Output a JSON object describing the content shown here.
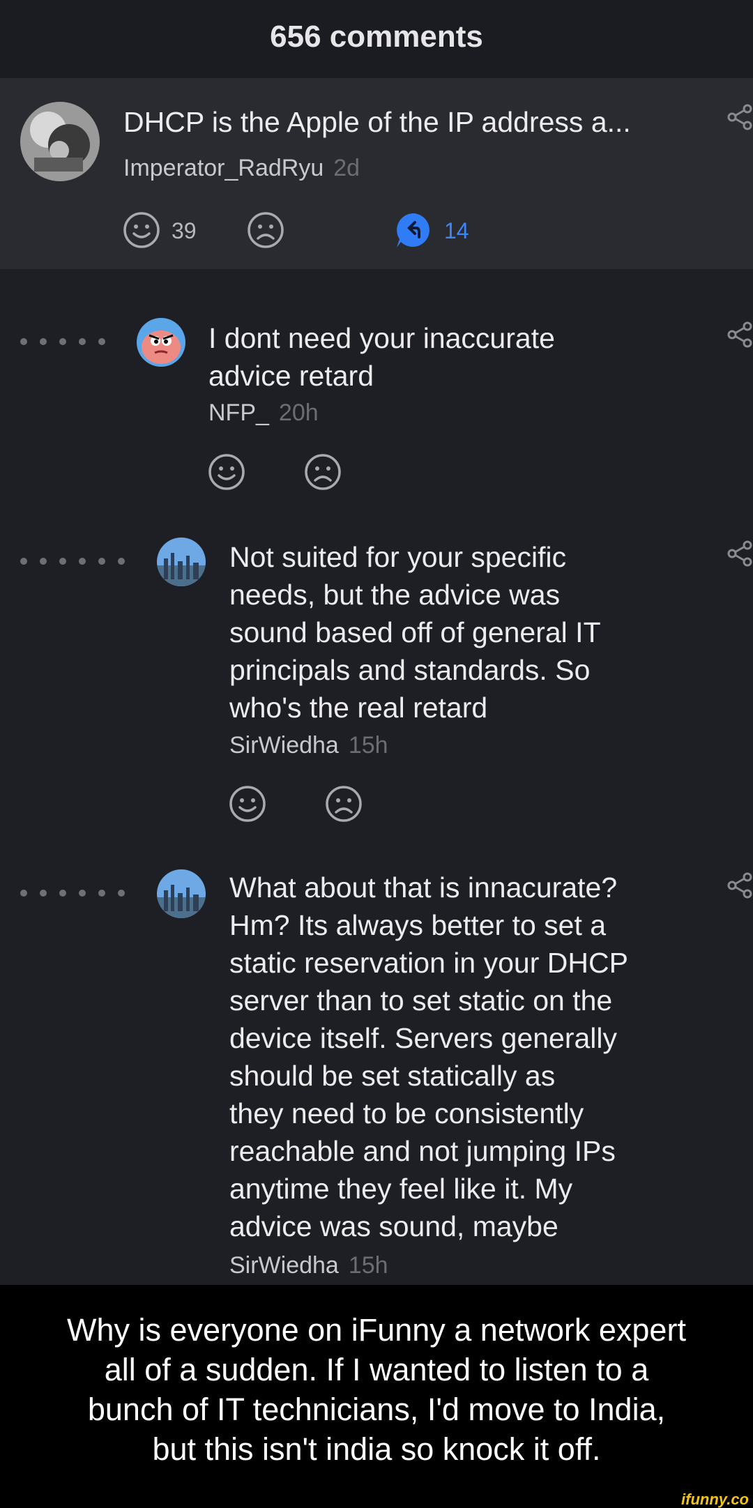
{
  "header": {
    "title": "656 comments"
  },
  "parent": {
    "text": "DHCP is the Apple of the IP address a...",
    "author": "Imperator_RadRyu",
    "age": "2d",
    "smile_count": "39",
    "reply_count": "14"
  },
  "replies": [
    {
      "text": "I dont need your inaccurate\nadvice retard",
      "author": "NFP_",
      "age": "20h"
    },
    {
      "text": "Not suited for your specific\nneeds, but the advice was\nsound based off of general IT\nprincipals and standards. So\nwho's the real retard",
      "author": "SirWiedha",
      "age": "15h"
    },
    {
      "text": "What about that is innacurate?\nHm? Its always better to set a\nstatic reservation in your DHCP\nserver than to set static on the\ndevice itself. Servers generally\nshould be set statically as\nthey need to be consistently\nreachable and not jumping IPs\nanytime they feel like it. My\nadvice was sound, maybe",
      "author": "SirWiedha",
      "age": "15h"
    }
  ],
  "caption": "Why is everyone on iFunny a network expert\nall of a sudden. If I wanted to listen to a\nbunch of IT technicians, I'd move to India,\nbut this isn't india so knock it off.",
  "watermark": "ifunny.co",
  "colors": {
    "accent": "#2f7cf6",
    "background": "#1e1f24",
    "parent_bg": "#2a2b31",
    "watermark": "#f2c417"
  }
}
